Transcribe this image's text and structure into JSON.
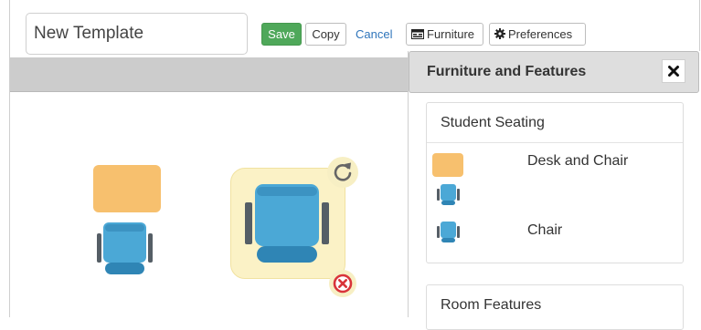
{
  "toolbar": {
    "template_name": "New Template",
    "save_label": "Save",
    "copy_label": "Copy",
    "cancel_label": "Cancel",
    "furniture_label": "Furniture",
    "preferences_label": "Preferences"
  },
  "panel": {
    "title": "Furniture and Features",
    "close_glyph": "✖",
    "sections": [
      {
        "title": "Student Seating",
        "items": [
          {
            "label": "Desk and Chair",
            "icon": "desk-and-chair-icon"
          },
          {
            "label": "Chair",
            "icon": "chair-icon"
          }
        ]
      },
      {
        "title": "Room Features"
      }
    ]
  },
  "canvas": {
    "items": [
      {
        "type": "desk-and-chair",
        "selected": false
      },
      {
        "type": "chair",
        "selected": true
      }
    ],
    "handles": {
      "rotate_glyph": "↻",
      "remove_glyph": "⊗"
    }
  },
  "colors": {
    "save_green": "#4fa85a",
    "link_blue": "#2f75bb",
    "desk_orange": "#f7c06e",
    "chair_blue": "#4ba8d6",
    "selection_yellow": "#fbf2c6",
    "remove_red": "#d9343a"
  }
}
